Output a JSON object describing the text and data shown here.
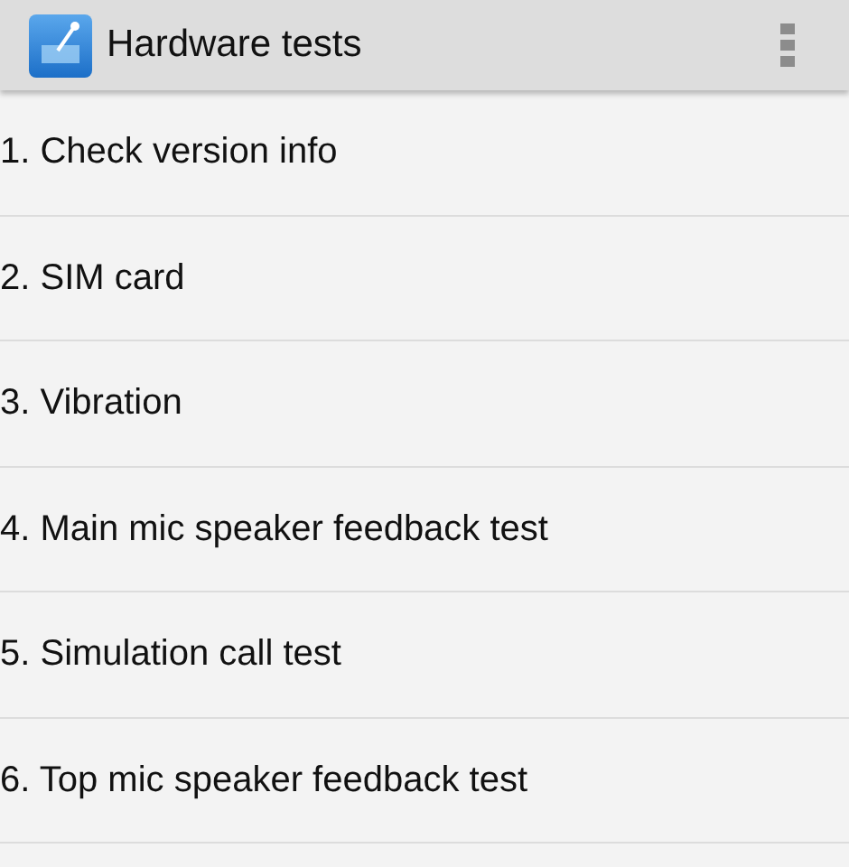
{
  "action_bar": {
    "title": "Hardware tests"
  },
  "items": [
    {
      "label": "1. Check version info"
    },
    {
      "label": "2. SIM card"
    },
    {
      "label": "3. Vibration"
    },
    {
      "label": "4. Main mic speaker feedback test"
    },
    {
      "label": "5. Simulation call test"
    },
    {
      "label": "6. Top mic speaker feedback test"
    }
  ]
}
